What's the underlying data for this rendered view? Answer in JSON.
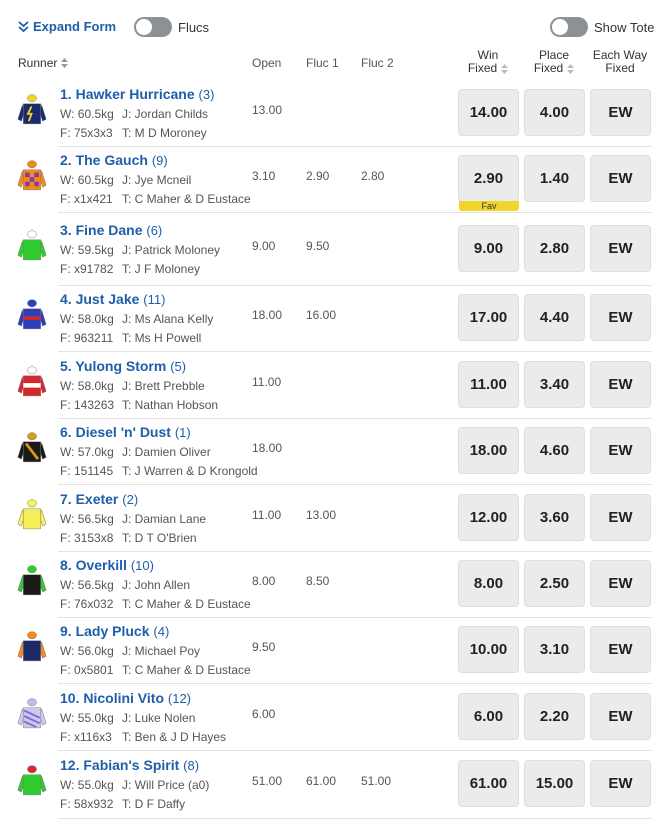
{
  "controls": {
    "expand_form_label": "Expand Form",
    "flucs_label": "Flucs",
    "show_tote_label": "Show Tote"
  },
  "header": {
    "runner": "Runner",
    "open": "Open",
    "fluc1": "Fluc 1",
    "fluc2": "Fluc 2",
    "win_line1": "Win",
    "win_line2": "Fixed",
    "place_line1": "Place",
    "place_line2": "Fixed",
    "ew_line1": "Each Way",
    "ew_line2": "Fixed"
  },
  "colors": {
    "link": "#1f5ea8",
    "fav_badge": "#f2d52b",
    "button_bg": "#ebebeb"
  },
  "runners": [
    {
      "number": "1.",
      "name": "Hawker Hurricane",
      "barrier": "(3)",
      "weight": "W: 60.5kg",
      "jockey": "J: Jordan Childs",
      "form": "F: 75x3x3",
      "trainer": "T: M D Moroney",
      "open": "13.00",
      "fluc1": "",
      "fluc2": "",
      "win": "14.00",
      "place": "4.00",
      "ew": "EW",
      "fav": "",
      "silk": "navy-yellow-bolt"
    },
    {
      "number": "2.",
      "name": "The Gauch",
      "barrier": "(9)",
      "weight": "W: 60.5kg",
      "jockey": "J: Jye Mcneil",
      "form": "F: x1x421",
      "trainer": "T: C Maher & D Eustace",
      "open": "3.10",
      "fluc1": "2.90",
      "fluc2": "2.80",
      "win": "2.90",
      "place": "1.40",
      "ew": "EW",
      "fav": "Fav",
      "silk": "orange-purple-check"
    },
    {
      "number": "3.",
      "name": "Fine Dane",
      "barrier": "(6)",
      "weight": "W: 59.5kg",
      "jockey": "J: Patrick Moloney",
      "form": "F: x91782",
      "trainer": "T: J F Moloney",
      "open": "9.00",
      "fluc1": "9.50",
      "fluc2": "",
      "win": "9.00",
      "place": "2.80",
      "ew": "EW",
      "fav": "",
      "silk": "green"
    },
    {
      "number": "4.",
      "name": "Just Jake",
      "barrier": "(11)",
      "weight": "W: 58.0kg",
      "jockey": "J: Ms Alana Kelly",
      "form": "F: 963211",
      "trainer": "T: Ms H Powell",
      "open": "18.00",
      "fluc1": "16.00",
      "fluc2": "",
      "win": "17.00",
      "place": "4.40",
      "ew": "EW",
      "fav": "",
      "silk": "blue-red-band"
    },
    {
      "number": "5.",
      "name": "Yulong Storm",
      "barrier": "(5)",
      "weight": "W: 58.0kg",
      "jockey": "J: Brett Prebble",
      "form": "F: 143263",
      "trainer": "T: Nathan Hobson",
      "open": "11.00",
      "fluc1": "",
      "fluc2": "",
      "win": "11.00",
      "place": "3.40",
      "ew": "EW",
      "fav": "",
      "silk": "red-white-band"
    },
    {
      "number": "6.",
      "name": "Diesel 'n' Dust",
      "barrier": "(1)",
      "weight": "W: 57.0kg",
      "jockey": "J: Damien Oliver",
      "form": "F: 151145",
      "trainer": "T: J Warren & D Krongold",
      "open": "18.00",
      "fluc1": "",
      "fluc2": "",
      "win": "18.00",
      "place": "4.60",
      "ew": "EW",
      "fav": "",
      "silk": "black-gold-sash"
    },
    {
      "number": "7.",
      "name": "Exeter",
      "barrier": "(2)",
      "weight": "W: 56.5kg",
      "jockey": "J: Damian Lane",
      "form": "F: 3153x8",
      "trainer": "T: D T O'Brien",
      "open": "11.00",
      "fluc1": "13.00",
      "fluc2": "",
      "win": "12.00",
      "place": "3.60",
      "ew": "EW",
      "fav": "",
      "silk": "yellow"
    },
    {
      "number": "8.",
      "name": "Overkill",
      "barrier": "(10)",
      "weight": "W: 56.5kg",
      "jockey": "J: John Allen",
      "form": "F: 76x032",
      "trainer": "T: C Maher & D Eustace",
      "open": "8.00",
      "fluc1": "8.50",
      "fluc2": "",
      "win": "8.00",
      "place": "2.50",
      "ew": "EW",
      "fav": "",
      "silk": "black-green-sleeves"
    },
    {
      "number": "9.",
      "name": "Lady Pluck",
      "barrier": "(4)",
      "weight": "W: 56.0kg",
      "jockey": "J: Michael Poy",
      "form": "F: 0x5801",
      "trainer": "T: C Maher & D Eustace",
      "open": "9.50",
      "fluc1": "",
      "fluc2": "",
      "win": "10.00",
      "place": "3.10",
      "ew": "EW",
      "fav": "",
      "silk": "navy-orange-sleeves"
    },
    {
      "number": "10.",
      "name": "Nicolini Vito",
      "barrier": "(12)",
      "weight": "W: 55.0kg",
      "jockey": "J: Luke Nolen",
      "form": "F: x116x3",
      "trainer": "T: Ben & J D Hayes",
      "open": "6.00",
      "fluc1": "",
      "fluc2": "",
      "win": "6.00",
      "place": "2.20",
      "ew": "EW",
      "fav": "",
      "silk": "blue-pink-stripes"
    },
    {
      "number": "12.",
      "name": "Fabian's Spirit",
      "barrier": "(8)",
      "weight": "W: 55.0kg",
      "jockey": "J: Will Price (a0)",
      "form": "F: 58x932",
      "trainer": "T: D F Daffy",
      "open": "51.00",
      "fluc1": "61.00",
      "fluc2": "51.00",
      "win": "61.00",
      "place": "15.00",
      "ew": "EW",
      "fav": "",
      "silk": "green-red-cap"
    }
  ]
}
